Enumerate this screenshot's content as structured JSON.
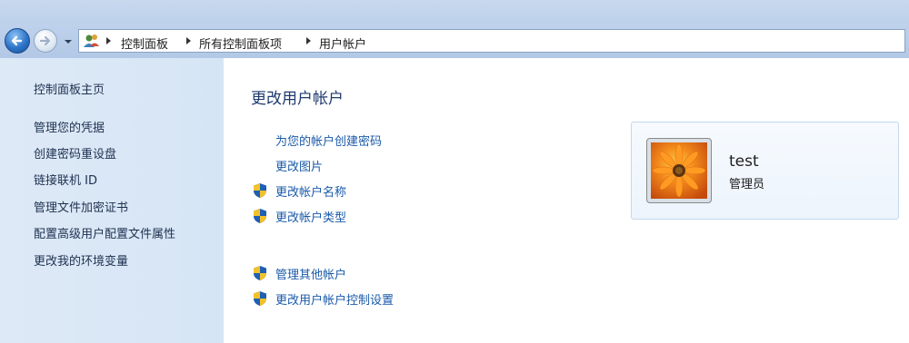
{
  "address_bar": {
    "breadcrumbs": [
      "控制面板",
      "所有控制面板项",
      "用户帐户"
    ]
  },
  "sidebar": {
    "home": "控制面板主页",
    "items": [
      "管理您的凭据",
      "创建密码重设盘",
      "链接联机 ID",
      "管理文件加密证书",
      "配置高级用户配置文件属性",
      "更改我的环境变量"
    ]
  },
  "main": {
    "title": "更改用户帐户",
    "tasks": [
      {
        "label": "为您的帐户创建密码",
        "icon": "none"
      },
      {
        "label": "更改图片",
        "icon": "none"
      },
      {
        "label": "更改帐户名称",
        "icon": "uac-shield-icon"
      },
      {
        "label": "更改帐户类型",
        "icon": "uac-shield-icon"
      }
    ],
    "other_tasks": [
      {
        "label": "管理其他帐户",
        "icon": "uac-shield-icon"
      },
      {
        "label": "更改用户帐户控制设置",
        "icon": "uac-shield-icon"
      }
    ]
  },
  "user_card": {
    "name": "test",
    "role": "管理员",
    "picture": "orange-flower-picture"
  },
  "colors": {
    "link": "#1a5aa8",
    "title": "#1e3a6e",
    "sidebar_bg": "#d6e5f5",
    "chrome_bg": "#bcd0ea"
  }
}
